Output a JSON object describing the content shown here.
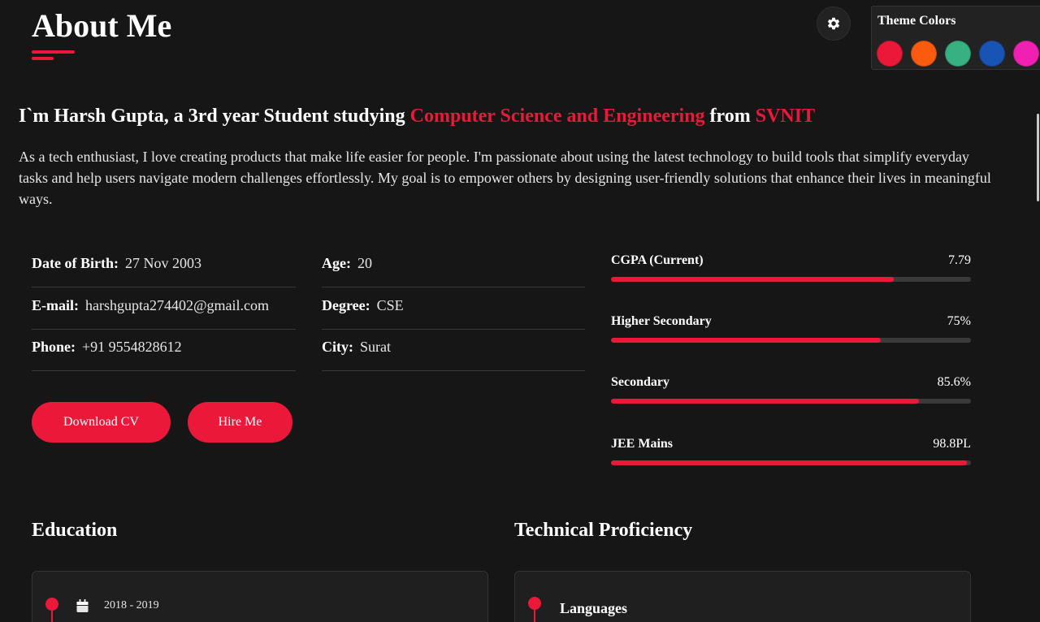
{
  "header": {
    "title": "About Me"
  },
  "settings": {
    "icon": "gear-icon"
  },
  "theme": {
    "title": "Theme Colors",
    "colors": [
      "#ec1839",
      "#fa5b0f",
      "#37b182",
      "#1854b4",
      "#f021b2"
    ]
  },
  "intro": {
    "heading_prefix": "I`m Harsh Gupta, a 3rd year Student studying ",
    "heading_major": "Computer Science and Engineering",
    "heading_from": " from ",
    "heading_college": "SVNIT",
    "paragraph": "As a tech enthusiast, I love creating products that make life easier for people. I'm passionate about using the latest technology to build tools that simplify everyday tasks and help users navigate modern challenges effortlessly. My goal is to empower others by designing user-friendly solutions that enhance their lives in meaningful ways."
  },
  "info": {
    "dob_label": "Date of Birth:",
    "dob": "27 Nov 2003",
    "email_label": "E-mail:",
    "email": "harshgupta274402@gmail.com",
    "phone_label": "Phone:",
    "phone": "+91 9554828612",
    "age_label": "Age:",
    "age": "20",
    "degree_label": "Degree:",
    "degree": "CSE",
    "city_label": "City:",
    "city": "Surat"
  },
  "buttons": {
    "download_cv": "Download CV",
    "hire_me": "Hire Me"
  },
  "skills": [
    {
      "label": "CGPA (Current)",
      "value": "7.79",
      "fill_percent": 78.5
    },
    {
      "label": "Higher Secondary",
      "value": "75%",
      "fill_percent": 75
    },
    {
      "label": "Secondary",
      "value": "85.6%",
      "fill_percent": 85.6
    },
    {
      "label": "JEE Mains",
      "value": "98.8PL",
      "fill_percent": 98.8
    }
  ],
  "education": {
    "title": "Education",
    "first_year": "2018 - 2019",
    "calendar_icon": "calendar-icon"
  },
  "technical": {
    "title": "Technical Proficiency",
    "first_item": "Languages"
  }
}
